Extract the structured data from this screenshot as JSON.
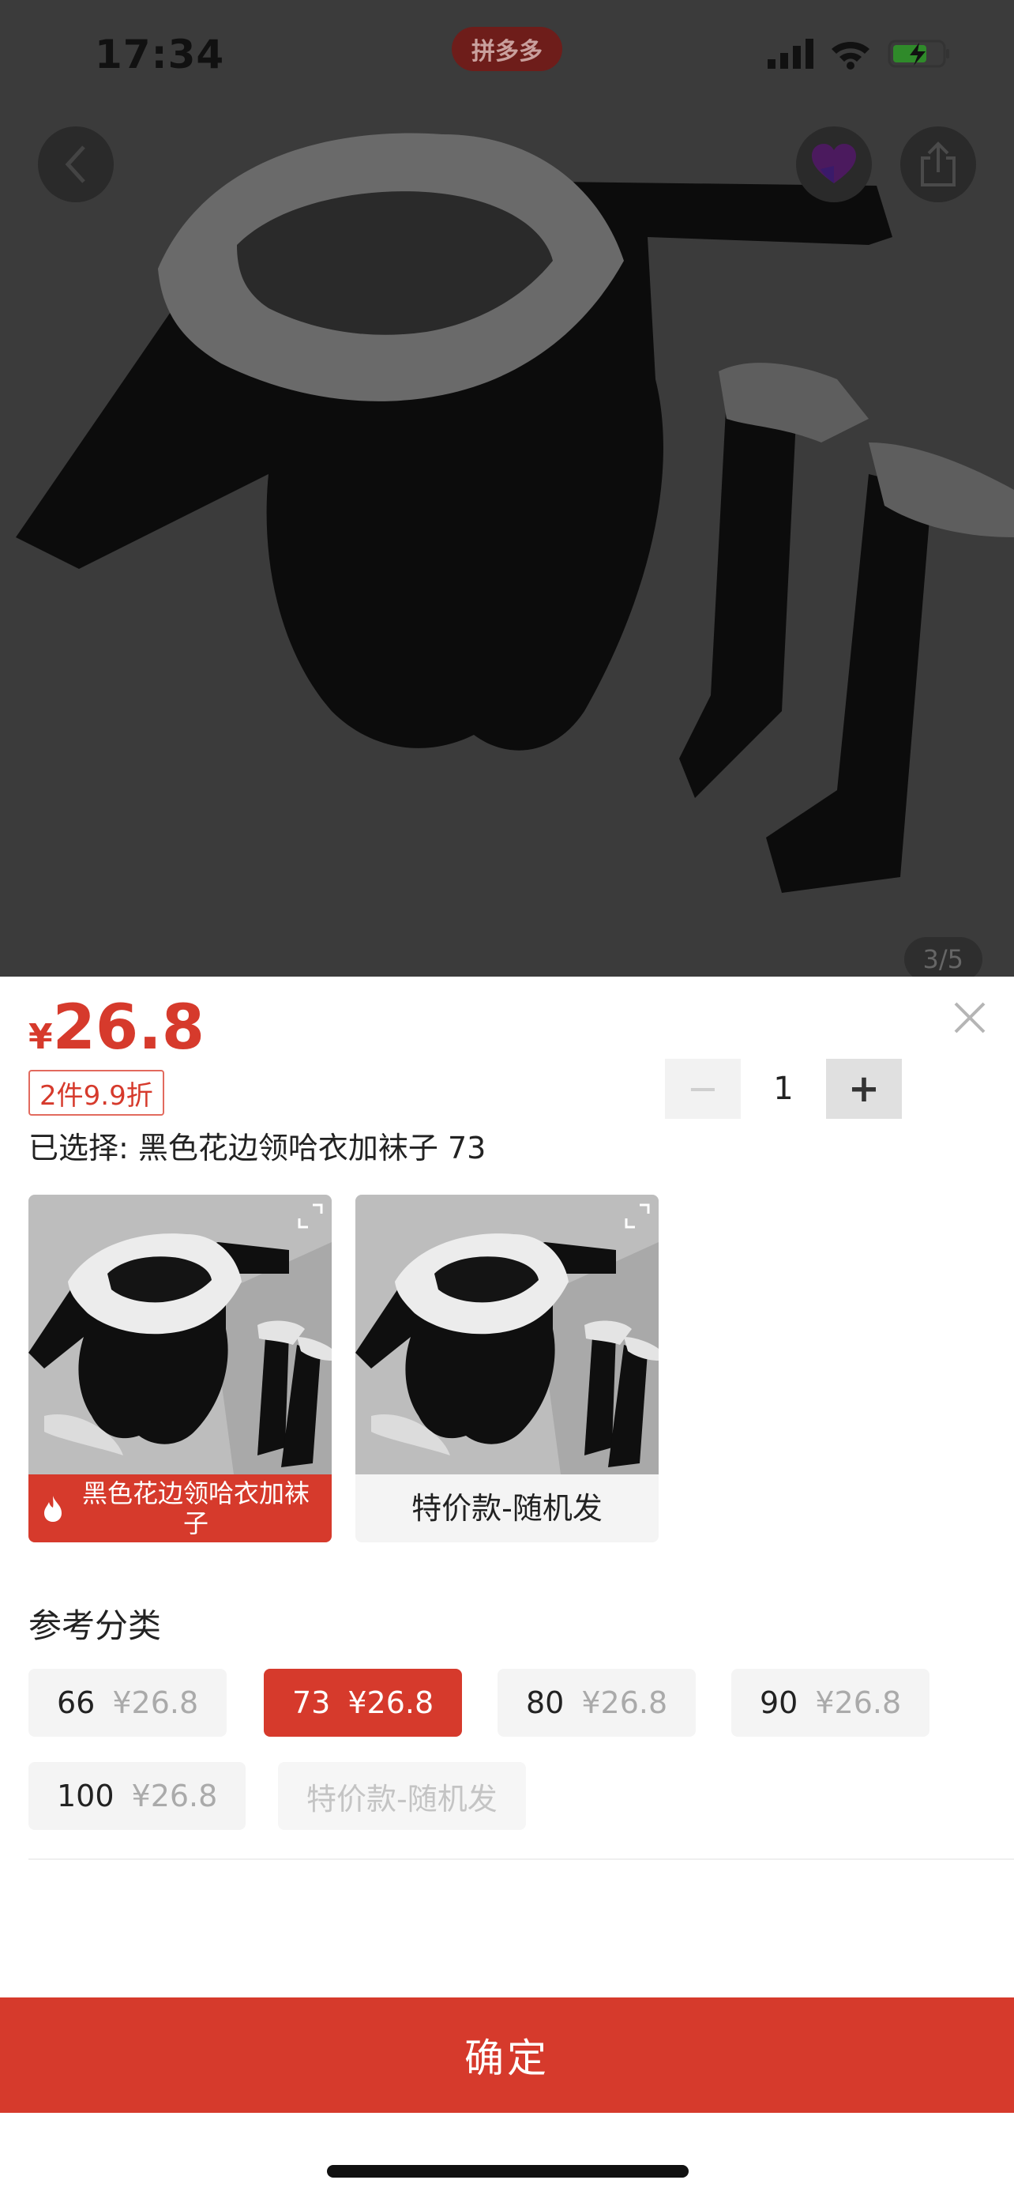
{
  "status_bar": {
    "time": "17:34",
    "app_pill": "拼多多"
  },
  "hero": {
    "image_counter": "3/5"
  },
  "sheet": {
    "currency": "¥",
    "price": "26.8",
    "promo_tag": "2件9.9折",
    "quantity": "1",
    "quantity_minus": "−",
    "quantity_plus": "+",
    "selected_label": "已选择: 黑色花边领哈衣加袜子 73",
    "options": [
      {
        "label": "黑色花边领哈衣加袜子",
        "selected": true,
        "hot_icon": "flame-icon"
      },
      {
        "label": "特价款-随机发",
        "selected": false
      }
    ],
    "size_section_title": "参考分类",
    "sizes": [
      {
        "size": "66",
        "price": "¥26.8",
        "state": "normal"
      },
      {
        "size": "73",
        "price": "¥26.8",
        "state": "selected"
      },
      {
        "size": "80",
        "price": "¥26.8",
        "state": "normal"
      },
      {
        "size": "90",
        "price": "¥26.8",
        "state": "normal"
      },
      {
        "size": "100",
        "price": "¥26.8",
        "state": "normal"
      },
      {
        "size": "特价款-随机发",
        "price": "",
        "state": "disabled"
      }
    ],
    "confirm_label": "确定"
  },
  "colors": {
    "accent": "#d63a2c",
    "chip_bg": "#f4f4f4",
    "hero_dim": "#3b3b3b"
  }
}
